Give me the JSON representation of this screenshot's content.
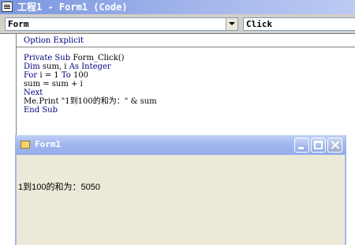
{
  "code_window": {
    "title": "工程1 - Form1 (Code)",
    "object_combo": "Form",
    "procedure_combo": "Click"
  },
  "code": {
    "option_line": "Option Explicit",
    "lines": [
      [
        {
          "t": "Private Sub ",
          "k": true
        },
        {
          "t": "Form_Click()",
          "k": false
        }
      ],
      [
        {
          "t": "Dim ",
          "k": true
        },
        {
          "t": "sum, i ",
          "k": false
        },
        {
          "t": "As Integer",
          "k": true
        }
      ],
      [
        {
          "t": "For ",
          "k": true
        },
        {
          "t": "i = 1 ",
          "k": false
        },
        {
          "t": "To ",
          "k": true
        },
        {
          "t": "100",
          "k": false
        }
      ],
      [
        {
          "t": "sum = sum + i",
          "k": false
        }
      ],
      [
        {
          "t": "Next",
          "k": true
        }
      ],
      [
        {
          "t": "Me.Print \"1到100的和为：\" & sum",
          "k": false
        }
      ],
      [
        {
          "t": "End Sub",
          "k": true
        }
      ]
    ]
  },
  "form_window": {
    "title": "Form1",
    "output": "1到100的和为：5050"
  },
  "colors": {
    "keyword": "#000080",
    "text": "#000000",
    "title_gradient_start": "#7a96df"
  },
  "icons": {
    "code_window": "code-window-icon",
    "form_window": "form-icon",
    "minimize": "minimize-icon",
    "maximize": "maximize-icon",
    "close": "close-icon",
    "dropdown": "chevron-down-icon"
  }
}
